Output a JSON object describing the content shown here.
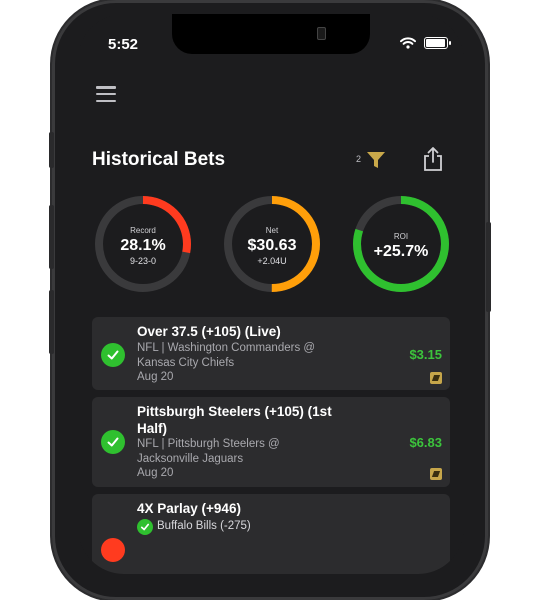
{
  "status_bar": {
    "time": "5:52",
    "icons": [
      "wifi-icon",
      "battery-icon"
    ]
  },
  "header": {
    "menu_icon": "hamburger-menu-icon",
    "title": "Historical Bets",
    "filter_count": "2",
    "filter_icon": "filter-funnel-icon",
    "share_icon": "share-icon"
  },
  "stats": [
    {
      "label": "Record",
      "value": "28.1%",
      "sub": "9-23-0",
      "color": "#ff3b1f",
      "fill_fraction": 0.28
    },
    {
      "label": "Net",
      "value": "$30.63",
      "sub": "+2.04U",
      "color": "#ff9f0a",
      "fill_fraction": 0.5
    },
    {
      "label": "ROI",
      "value": "+25.7%",
      "sub": "",
      "color": "#2fc02f",
      "fill_fraction": 0.8
    }
  ],
  "bets": [
    {
      "title": "Over 37.5 (+105) (Live)",
      "league": "NFL | Washington Commanders @ Kansas City Chiefs",
      "date": "Aug 20",
      "amount": "$3.15",
      "status": "won"
    },
    {
      "title": "Pittsburgh Steelers (+105) (1st Half)",
      "league": "NFL | Pittsburgh Steelers @ Jacksonville Jaguars",
      "date": "Aug 20",
      "amount": "$6.83",
      "status": "won"
    },
    {
      "title": "4X Parlay (+946)",
      "legs": [
        {
          "text": "Buffalo Bills (-275)",
          "status": "won"
        }
      ]
    }
  ],
  "colors": {
    "background": "#1c1c1e",
    "card": "#2c2c2e",
    "win_green": "#2fc02f",
    "amount_green": "#3cc43c",
    "ring_track": "#3a3a3c"
  }
}
